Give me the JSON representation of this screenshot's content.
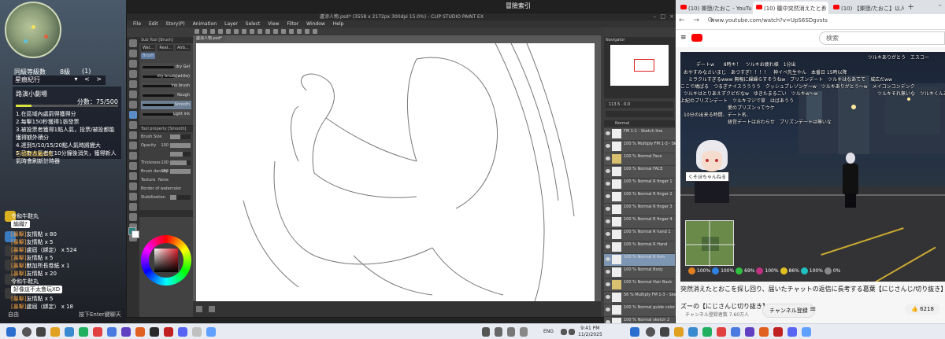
{
  "game": {
    "stats": [
      "同級等級數",
      "8級",
      "(1)"
    ],
    "quest_title": "星痕紀行",
    "quest_name": "路演小劇場",
    "score": "分數：75/500",
    "score_progress": 0.15,
    "items": [
      "1.在區域內處罰得獲得分",
      "2.每擊150秒獲得1張發票",
      "3.被投票者獲得1點人氣，投票/被投都能獲得額外積分",
      "4.達到5/10/15/20點人氣時將變大",
      "5.已有人氣者在10分鐘後消失，獲得新人氣時會刷新計時器"
    ],
    "quest_foot": "已領取獎勵2次",
    "chat": [
      {
        "who": "",
        "text": "令和牛鞋丸"
      },
      {
        "who": "",
        "text": "編織?"
      },
      {
        "who": "[暴擊]",
        "text": "友情點 x 80"
      },
      {
        "who": "[暴擊]",
        "text": "友情點 x 5"
      },
      {
        "who": "[暴擊]",
        "text": "盧屆（綁定） x 524"
      },
      {
        "who": "[暴擊]",
        "text": "友情點 x 5"
      },
      {
        "who": "[暴擊]",
        "text": "獸加所長卷紙 x 1"
      },
      {
        "who": "[暴擊]",
        "text": "友情點 x 20"
      },
      {
        "who": "",
        "text": "令和牛鞋丸"
      },
      {
        "who": "",
        "text": "好像這不太會玩XD"
      },
      {
        "who": "[暴擊]",
        "text": "友情點 x 5"
      },
      {
        "who": "[暴擊]",
        "text": "盧屆（綁定） x 18"
      }
    ],
    "chat_hint": "按下Enter鍵聊天",
    "chat_channel": "自由"
  },
  "topstrip": {
    "bg_text": "冒險索引"
  },
  "csp": {
    "title": "盧涼人物.psd* (3558 x 2172px 300dpi 15.0%) - CLIP STUDIO PAINT EX",
    "menus": [
      "File",
      "Edit",
      "Story(P)",
      "Animation",
      "Layer",
      "Select",
      "View",
      "Filter",
      "Window",
      "Help"
    ],
    "doc_tab": "盧涼人物.psd*",
    "subtool_header": "Sub Tool [Brush]",
    "subtool_groups": [
      "Wat...",
      "Real...",
      "Airb...",
      "Brush"
    ],
    "brushes": [
      "dry Gel",
      "dry brush(white)",
      "Ink brush",
      "Rough",
      "Smooth",
      "Light ink"
    ],
    "selected_brush": 4,
    "prop_header": "Tool property [Smooth]",
    "prop_rows": [
      {
        "label": "Brush Size",
        "value": "",
        "level": 0.5
      },
      {
        "label": "Opacity",
        "value": "100",
        "level": 1.0
      },
      {
        "label": "",
        "value": "",
        "level": 0.6
      },
      {
        "label": "Thickness",
        "value": "100",
        "level": 0.8
      },
      {
        "label": "Brush density",
        "value": "100",
        "level": 1.0
      },
      {
        "label": "Texture",
        "value": "None",
        "level": 0
      },
      {
        "label": "Border of watercolor",
        "value": "",
        "level": 0
      },
      {
        "label": "Stabilization",
        "value": "",
        "level": 0.3
      }
    ],
    "nav_header": "Navigator",
    "zoom": "113.5",
    "angle": "0.0",
    "layer_mode": "Normal",
    "layers": [
      {
        "title": "FM 1-1 - Sketch line",
        "folder": false
      },
      {
        "title": "100 % Multiply FM 1-3 - Sketch line",
        "folder": false
      },
      {
        "title": "100 % Normal Face",
        "folder": true
      },
      {
        "title": "100 % Normal FACE",
        "folder": false
      },
      {
        "title": "100 % Normal R finger 1",
        "folder": false
      },
      {
        "title": "100 % Normal R finger 2",
        "folder": false
      },
      {
        "title": "100 % Normal R finger 3",
        "folder": false
      },
      {
        "title": "100 % Normal R finger 4",
        "folder": false
      },
      {
        "title": "100 % Normal R hand 1",
        "folder": false
      },
      {
        "title": "100 % Normal R Hand",
        "folder": false
      },
      {
        "title": "100 % Normal R Arm",
        "folder": false,
        "selected": true
      },
      {
        "title": "100 % Normal Body",
        "folder": false
      },
      {
        "title": "100 % Normal Hair Back",
        "folder": true
      },
      {
        "title": "56 % Multiply FM 1-3 - Sketch line",
        "folder": false
      },
      {
        "title": "100 % Normal guide color",
        "folder": false
      },
      {
        "title": "100 % Normal sketch 2",
        "folder": false
      }
    ]
  },
  "youtube": {
    "tabs": [
      {
        "label": "(10) 樂墮/たおこ - YouTube",
        "active": false
      },
      {
        "label": "(10) 聽中突然消えたとお",
        "active": true
      },
      {
        "label": "(10) 【樂墮/たおこ】以人間加",
        "active": false
      }
    ],
    "url": "www.youtube.com/watch?v=UpS6SDgvsts",
    "search_placeholder": "検索",
    "danmaku": [
      "ツルキありがとう　エスコー",
      "デートw　　8時キ！　ツルキお疲れ様　1分出",
      "おやすみなさいまじ　あつすぎ！！！！　神イベ先生やん　本番日 15時以降",
      "ミラクルすぎるwww 無報に繰繰らすそうねw　ブリズンデート　ツルキはなあてて　城広だww",
      "ここで鳩ぱる　つるぎナイスうううう　クッシュプレゾンゲーw　ツルキありがとう～w　メイコンコンデンク",
      "ツルキはとりあえずクビだなw　ゆきたまるごい　ツルキw～w",
      "上紀のプリズンデート　ツルキマジで草　はばあうう",
      "愛のプリズンってウケ",
      "10分の出来る時間、デート名、",
      "経営デートはおわらせ　ブリズンデートは無いな",
      "ツルキそれ無いな　ツルキくんありが"
    ],
    "nametag": "くそほちゃんねる",
    "hud": [
      "100%",
      "100%",
      "69%",
      "100%",
      "86%",
      "100%",
      "0%"
    ],
    "title": "突然消えたとおこを探し回り、届いたチャットの返信に長考する葛葉【にじさんじ/切り抜き】",
    "channel": "ズーの【にじさんじ切り抜き】",
    "subs": "チャンネル登録者数 7.60万人",
    "subscribe": "チャンネル登録",
    "likes": "6218"
  },
  "taskbar": {
    "lang": "ENG",
    "time": "9:41 PM",
    "date": "11/2/2025"
  }
}
